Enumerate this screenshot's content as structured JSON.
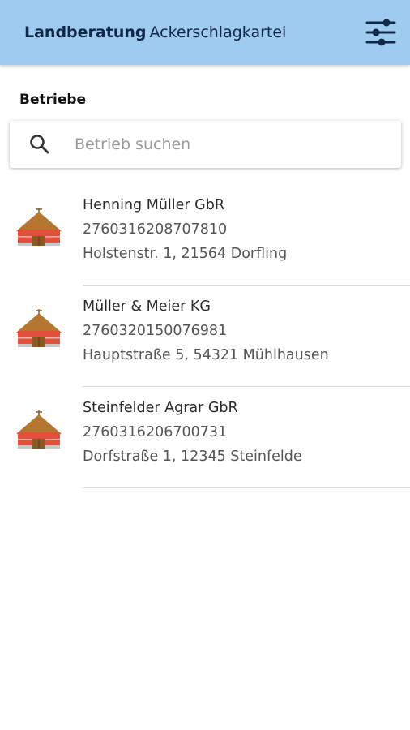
{
  "appbar": {
    "title_bold": "Landberatung",
    "title_regular": "Ackerschlagkartei",
    "filter_icon": "tune-sliders-icon"
  },
  "section": {
    "title": "Betriebe"
  },
  "search": {
    "placeholder": "Betrieb suchen",
    "icon": "search-icon"
  },
  "farms": [
    {
      "name": "Henning Müller GbR",
      "id": "2760316208707810",
      "address": "Holstenstr. 1, 21564 Dorfling",
      "icon": "barn-icon"
    },
    {
      "name": "Müller & Meier KG",
      "id": "2760320150076981",
      "address": "Hauptstraße 5, 54321 Mühlhausen",
      "icon": "barn-icon"
    },
    {
      "name": "Steinfelder Agrar GbR",
      "id": "2760316206700731",
      "address": "Dorfstraße 1, 12345 Steinfelde",
      "icon": "barn-icon"
    }
  ],
  "colors": {
    "appbar_bg": "#9ecbee",
    "title_text": "#0f2748",
    "barn_roof": "#b5772f",
    "barn_wall": "#e2503c",
    "barn_door": "#8a5a22"
  }
}
